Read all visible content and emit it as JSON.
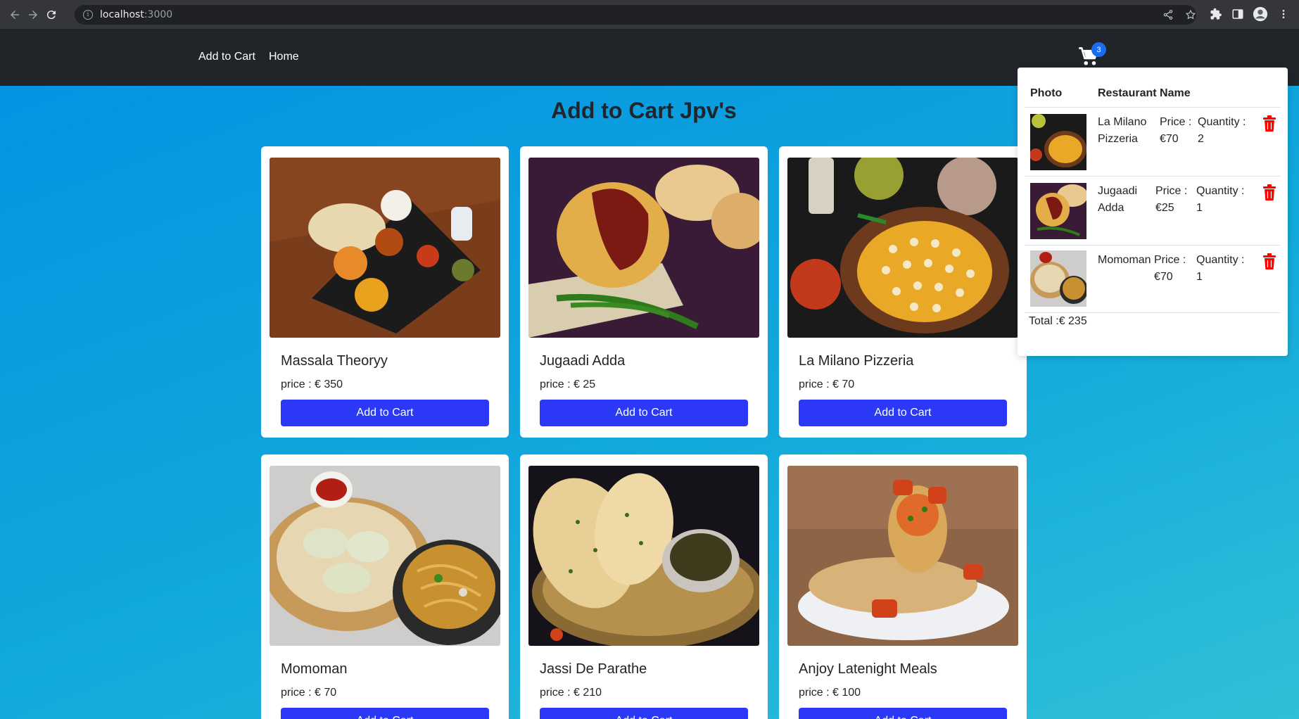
{
  "browser": {
    "url_host": "localhost",
    "url_port": ":3000"
  },
  "navbar": {
    "brand": "Add to Cart",
    "home": "Home",
    "cart_count": "3"
  },
  "page": {
    "title": "Add to Cart Jpv's"
  },
  "products": [
    {
      "name": "Massala Theoryy",
      "price": "price : € 350",
      "button": "Add to Cart"
    },
    {
      "name": "Jugaadi Adda",
      "price": "price : € 25",
      "button": "Add to Cart"
    },
    {
      "name": "La Milano Pizzeria",
      "price": "price : € 70",
      "button": "Add to Cart"
    },
    {
      "name": "Momoman",
      "price": "price : € 70",
      "button": "Add to Cart"
    },
    {
      "name": "Jassi De Parathe",
      "price": "price : € 210",
      "button": "Add to Cart"
    },
    {
      "name": "Anjoy Latenight Meals",
      "price": "price : € 100",
      "button": "Add to Cart"
    }
  ],
  "cart": {
    "col_photo": "Photo",
    "col_name": "Restaurant Name",
    "items": [
      {
        "name_l1": "La Milano",
        "name_l2": "Pizzeria",
        "price_l1": "Price :",
        "price_l2": "€70",
        "qty_l1": "Quantity :",
        "qty_l2": "2"
      },
      {
        "name_l1": "Jugaadi",
        "name_l2": "Adda",
        "price_l1": "Price :",
        "price_l2": "€25",
        "qty_l1": "Quantity :",
        "qty_l2": "1"
      },
      {
        "name_l1": "Momoman",
        "name_l2": "",
        "price_l1": "Price :",
        "price_l2": "€70",
        "qty_l1": "Quantity :",
        "qty_l2": "1"
      }
    ],
    "total": "Total :€ 235"
  },
  "colors": {
    "navbar": "#212529",
    "button": "#2b39f7",
    "badge": "#1a6df0",
    "trash": "#ff0000",
    "background": "#0aa0d8"
  }
}
